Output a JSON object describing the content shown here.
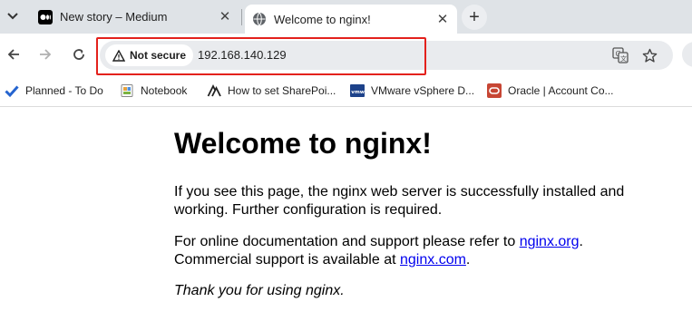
{
  "tabs": [
    {
      "title": "New story – Medium",
      "favicon": "medium-icon",
      "active": false
    },
    {
      "title": "Welcome to nginx!",
      "favicon": "globe-icon",
      "active": true
    }
  ],
  "toolbar": {
    "security_label": "Not secure",
    "url": "192.168.140.129"
  },
  "bookmarks": [
    {
      "label": "Planned - To Do",
      "icon": "checkmark-icon"
    },
    {
      "label": "Notebook",
      "icon": "notebook-icon"
    },
    {
      "label": "How to set SharePoi...",
      "icon": "lambda-icon"
    },
    {
      "label": "VMware vSphere D...",
      "icon": "vmware-icon"
    },
    {
      "label": "Oracle | Account Co...",
      "icon": "oracle-icon"
    }
  ],
  "page": {
    "heading": "Welcome to nginx!",
    "p1": "If you see this page, the nginx web server is successfully installed and working. Further configuration is required.",
    "p2_before": "For online documentation and support please refer to ",
    "p2_link1": "nginx.org",
    "p2_mid": ".",
    "p2_line2": "Commercial support is available at ",
    "p2_link2": "nginx.com",
    "p2_end": ".",
    "p3": "Thank you for using nginx."
  },
  "colors": {
    "highlight": "#e3211c",
    "link": "#0000ee",
    "tabstrip": "#dfe3e7"
  }
}
